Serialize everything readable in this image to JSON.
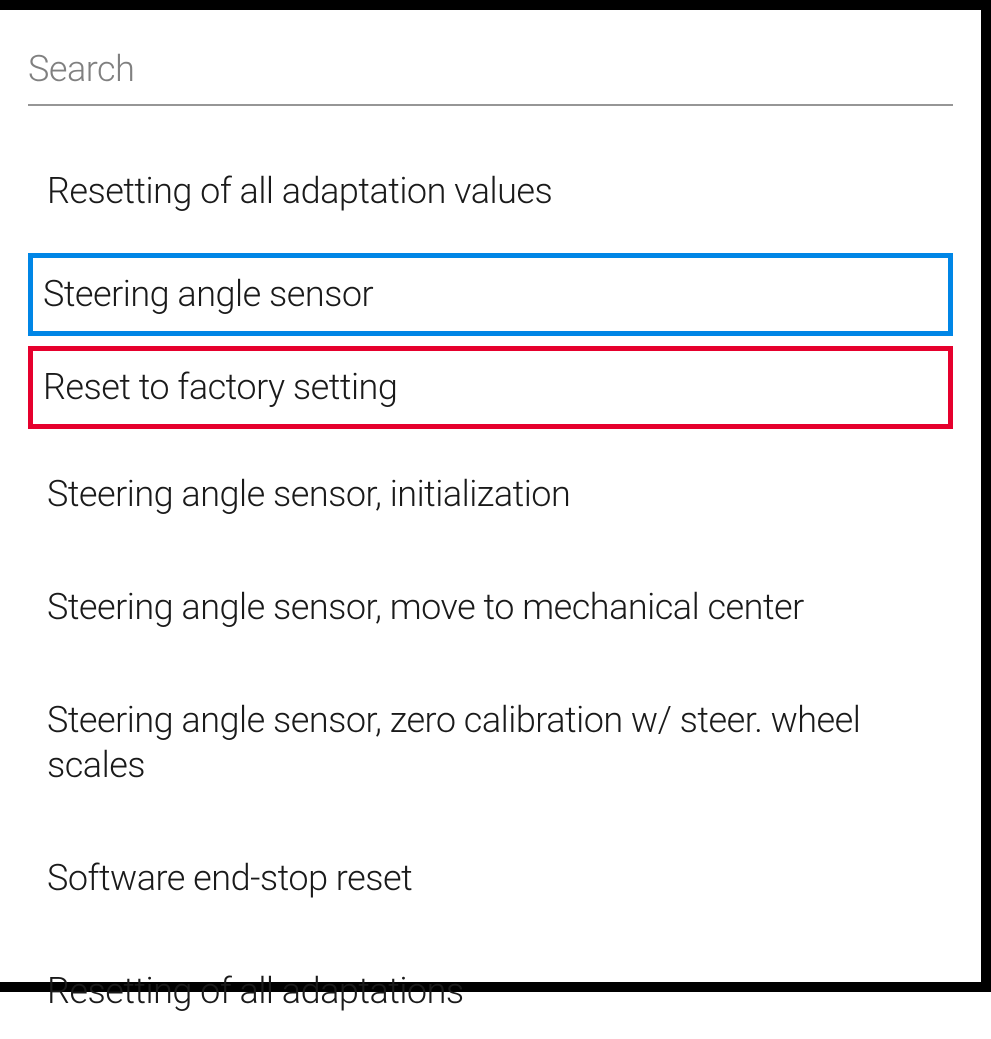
{
  "search": {
    "placeholder": "Search",
    "value": ""
  },
  "items": [
    {
      "label": "Resetting of all adaptation values",
      "highlight": "none"
    },
    {
      "label": "Steering angle sensor",
      "highlight": "blue"
    },
    {
      "label": "Reset to factory setting",
      "highlight": "red"
    },
    {
      "label": "Steering angle sensor, initialization",
      "highlight": "none"
    },
    {
      "label": "Steering angle sensor, move to mechanical center",
      "highlight": "none"
    },
    {
      "label": "Steering angle sensor, zero calibration w/ steer. wheel scales",
      "highlight": "none"
    },
    {
      "label": "Software end-stop reset",
      "highlight": "none"
    },
    {
      "label": "Resetting of all adaptations",
      "highlight": "none"
    }
  ],
  "colors": {
    "highlight_blue": "#0086e6",
    "highlight_red": "#e6002d"
  }
}
